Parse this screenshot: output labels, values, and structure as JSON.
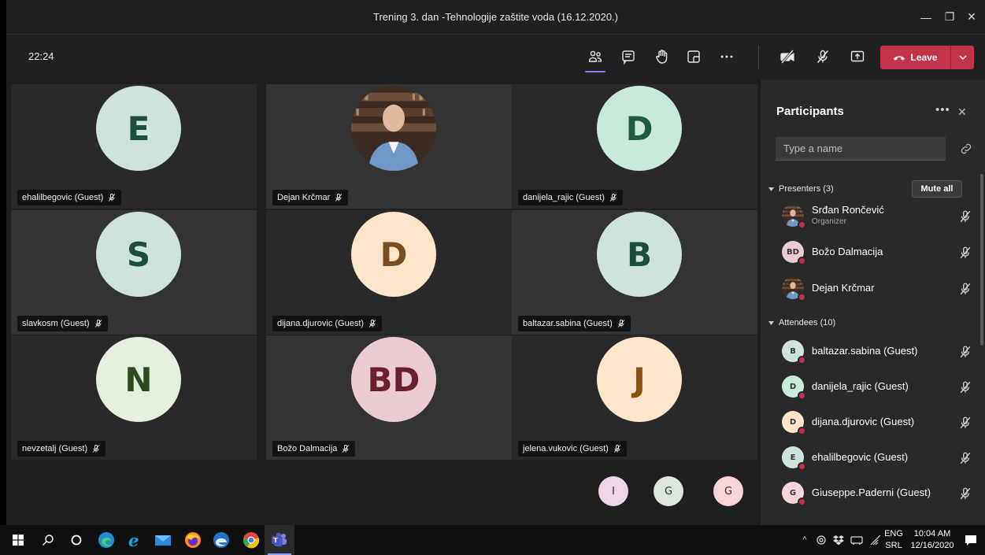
{
  "window": {
    "title": "Trening 3. dan -Tehnologije zaštite voda (16.12.2020.)",
    "minimize": "—",
    "maximize": "❐",
    "close": "✕"
  },
  "toolbar": {
    "timer": "22:24",
    "leave_label": "Leave"
  },
  "tiles": [
    {
      "name": "ehalilbegovic (Guest)",
      "initials": "E",
      "bg": "#cfe3dd",
      "fg": "#1e4d3f"
    },
    {
      "name": "Dejan Krčmar",
      "initials": "",
      "photo": true
    },
    {
      "name": "danijela_rajic (Guest)",
      "initials": "D",
      "bg": "#c9eadb",
      "fg": "#1d5b41"
    },
    {
      "name": "slavkosm (Guest)",
      "initials": "S",
      "bg": "#cfe3dd",
      "fg": "#1e4d3f"
    },
    {
      "name": "dijana.djurovic (Guest)",
      "initials": "D",
      "bg": "#fde5cc",
      "fg": "#7a4e1d"
    },
    {
      "name": "baltazar.sabina (Guest)",
      "initials": "B",
      "bg": "#cfe3dd",
      "fg": "#1e4d3f"
    },
    {
      "name": "nevzetalj (Guest)",
      "initials": "N",
      "bg": "#e5efdd",
      "fg": "#2e4a23"
    },
    {
      "name": "Božo Dalmacija",
      "initials": "BD",
      "bg": "#ecccd3",
      "fg": "#6b1f2f"
    },
    {
      "name": "jelena.vukovic (Guest)",
      "initials": "J",
      "bg": "#fde5cc",
      "fg": "#8a5114"
    }
  ],
  "overflow_avatars": [
    {
      "initials": "I",
      "bg": "#f0d6ea"
    },
    {
      "initials": "G",
      "bg": "#dde6dd"
    },
    {
      "initials": "G",
      "bg": "#f7d5d8"
    }
  ],
  "panel": {
    "title": "Participants",
    "more": "•••",
    "close": "✕",
    "search_placeholder": "Type a name",
    "presenters_label": "Presenters (3)",
    "mute_all": "Mute all",
    "attendees_label": "Attendees (10)",
    "presenters": [
      {
        "name": "Srđan Rončević",
        "role": "Organizer",
        "initials": "",
        "photo": true
      },
      {
        "name": "Božo Dalmacija",
        "initials": "BD",
        "bg": "#ecccd3"
      },
      {
        "name": "Dejan Krčmar",
        "initials": "",
        "photo": true
      }
    ],
    "attendees": [
      {
        "name": "baltazar.sabina (Guest)",
        "initials": "B",
        "bg": "#cfe3dd"
      },
      {
        "name": "danijela_rajic (Guest)",
        "initials": "D",
        "bg": "#c9eadb"
      },
      {
        "name": "dijana.djurovic (Guest)",
        "initials": "D",
        "bg": "#fde5cc"
      },
      {
        "name": "ehalilbegovic (Guest)",
        "initials": "E",
        "bg": "#cfe3dd"
      },
      {
        "name": "Giuseppe.Paderni (Guest)",
        "initials": "G",
        "bg": "#f7d5d8"
      }
    ]
  },
  "taskbar": {
    "lang_top": "ENG",
    "lang_bottom": "SRL",
    "time": "10:04 AM",
    "date": "12/16/2020"
  },
  "colors": {
    "accent": "#7f85f5",
    "leave": "#c4314b"
  }
}
